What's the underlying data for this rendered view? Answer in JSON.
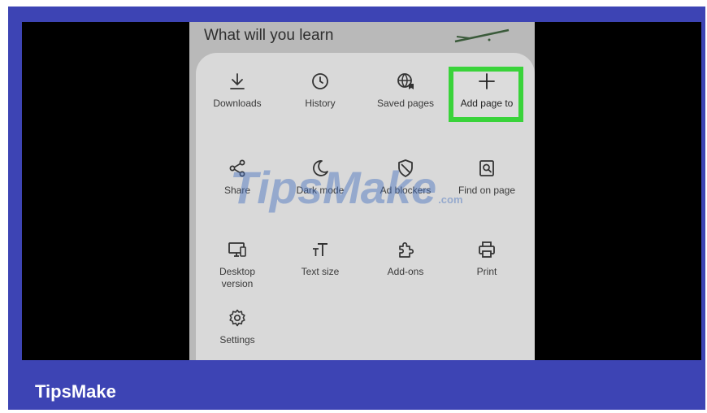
{
  "page": {
    "heading": "What will you learn"
  },
  "menu": {
    "items": [
      {
        "key": "downloads",
        "label": "Downloads",
        "icon": "download-icon"
      },
      {
        "key": "history",
        "label": "History",
        "icon": "history-icon"
      },
      {
        "key": "saved-pages",
        "label": "Saved pages",
        "icon": "saved-pages-icon"
      },
      {
        "key": "add-page-to",
        "label": "Add page to",
        "icon": "plus-icon",
        "highlighted": true
      },
      {
        "key": "share",
        "label": "Share",
        "icon": "share-icon"
      },
      {
        "key": "dark-mode",
        "label": "Dark mode",
        "icon": "moon-icon"
      },
      {
        "key": "ad-blockers",
        "label": "Ad blockers",
        "icon": "shield-icon"
      },
      {
        "key": "find-on-page",
        "label": "Find on page",
        "icon": "find-icon"
      },
      {
        "key": "desktop-version",
        "label": "Desktop\nversion",
        "icon": "desktop-icon"
      },
      {
        "key": "text-size",
        "label": "Text size",
        "icon": "text-size-icon"
      },
      {
        "key": "add-ons",
        "label": "Add-ons",
        "icon": "puzzle-icon"
      },
      {
        "key": "print",
        "label": "Print",
        "icon": "printer-icon"
      },
      {
        "key": "settings",
        "label": "Settings",
        "icon": "gear-icon"
      }
    ]
  },
  "watermark": {
    "main": "TipsMake",
    "suffix": ".com"
  },
  "brand": {
    "text": "TipsMake"
  },
  "colors": {
    "frame": "#3d44b4",
    "highlight": "#39d33a",
    "sheet": "#d9d9d9"
  }
}
